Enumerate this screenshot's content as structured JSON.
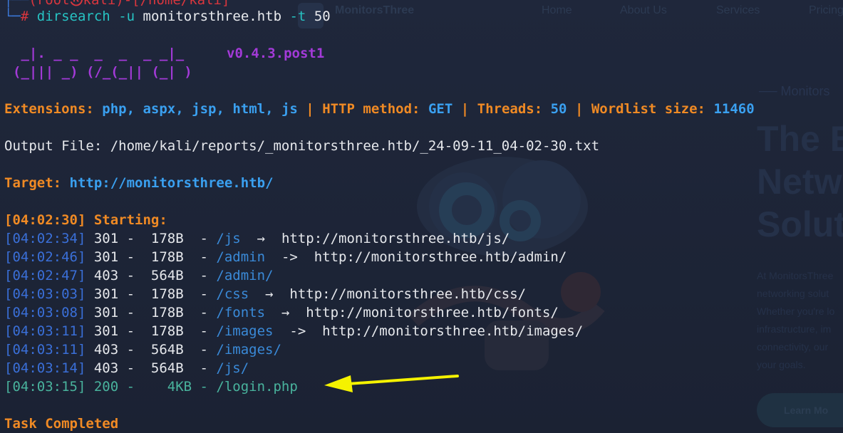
{
  "background_site": {
    "brand": "MonitorsThree",
    "nav": [
      "Home",
      "About Us",
      "Services",
      "Pricing"
    ],
    "brand_small": "Monitors",
    "heading_lines": [
      "The B",
      "Netw",
      "Solut"
    ],
    "paragraph_lines": [
      "At MonitorsThree",
      "networking solut",
      "Whether you're lo",
      "infrastructure, im",
      "connectivity, our",
      "your goals."
    ],
    "button_label": "Learn Mo"
  },
  "terminal": {
    "prompt_top": "(root㉿kali)-[/home/kali]",
    "prompt_marker": "└─",
    "prompt_hash": "#",
    "command_name": "dirsearch",
    "command_flag_u": "-u",
    "command_target": "monitorsthree.htb",
    "command_flag_t": "-t",
    "command_threads": "50",
    "banner_line1": " _|. _ _  _  _  _ _|_",
    "banner_line2": "(_||| _) (/_(_|| (_| )",
    "version": "v0.4.3.post1",
    "config": {
      "extensions_label": "Extensions:",
      "extensions_value": "php, aspx, jsp, html, js",
      "sep": "|",
      "method_label": "HTTP method:",
      "method_value": "GET",
      "threads_label": "Threads:",
      "threads_value": "50",
      "wordlist_label": "Wordlist size:",
      "wordlist_value": "11460"
    },
    "output_file": "Output File: /home/kali/reports/_monitorsthree.htb/_24-09-11_04-02-30.txt",
    "target_label": "Target:",
    "target_url": "http://monitorsthree.htb/",
    "starting_ts": "[04:02:30]",
    "starting_label": "Starting:",
    "results": [
      {
        "ts": "[04:02:34]",
        "info": " 301 -  178B  - ",
        "path": "/js",
        "redirect": "  →  http://monitorsthree.htb/js/",
        "kind": "redirect"
      },
      {
        "ts": "[04:02:46]",
        "info": " 301 -  178B  - ",
        "path": "/admin",
        "redirect": "  ->  http://monitorsthree.htb/admin/",
        "kind": "redirect"
      },
      {
        "ts": "[04:02:47]",
        "info": " 403 -  564B  - ",
        "path": "/admin/",
        "redirect": "",
        "kind": "forbidden"
      },
      {
        "ts": "[04:03:03]",
        "info": " 301 -  178B  - ",
        "path": "/css",
        "redirect": "  →  http://monitorsthree.htb/css/",
        "kind": "redirect"
      },
      {
        "ts": "[04:03:08]",
        "info": " 301 -  178B  - ",
        "path": "/fonts",
        "redirect": "  →  http://monitorsthree.htb/fonts/",
        "kind": "redirect"
      },
      {
        "ts": "[04:03:11]",
        "info": " 301 -  178B  - ",
        "path": "/images",
        "redirect": "  ->  http://monitorsthree.htb/images/",
        "kind": "redirect"
      },
      {
        "ts": "[04:03:11]",
        "info": " 403 -  564B  - ",
        "path": "/images/",
        "redirect": "",
        "kind": "forbidden"
      },
      {
        "ts": "[04:03:14]",
        "info": " 403 -  564B  - ",
        "path": "/js/",
        "redirect": "",
        "kind": "forbidden"
      },
      {
        "ts": "[04:03:15]",
        "info": " 200 -    4KB - ",
        "path": "/login.php",
        "redirect": "",
        "kind": "ok"
      }
    ],
    "task_completed": "Task Completed"
  },
  "colors": {
    "arrow": "#f5f200",
    "orange": "#f08a24",
    "purple": "#a33ad8",
    "ok_green": "#49b39d"
  }
}
